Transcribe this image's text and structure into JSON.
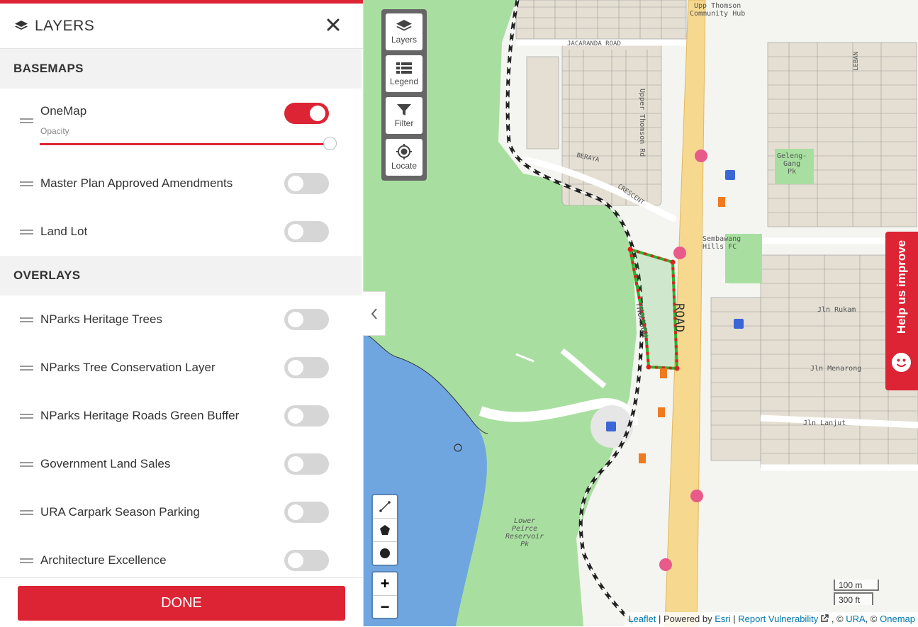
{
  "sidebar": {
    "title": "LAYERS",
    "title_icon": "layers-icon",
    "close_icon": "close-icon",
    "basemaps_heading": "BASEMAPS",
    "onemap": {
      "label": "OneMap",
      "enabled": true,
      "opacity_label": "Opacity",
      "opacity": 1.0
    },
    "basemaps": [
      {
        "label": "Master Plan Approved Amendments",
        "enabled": false
      },
      {
        "label": "Land Lot",
        "enabled": false
      }
    ],
    "overlays_heading": "OVERLAYS",
    "overlays": [
      {
        "label": "NParks Heritage Trees",
        "enabled": false
      },
      {
        "label": "NParks Tree Conservation Layer",
        "enabled": false
      },
      {
        "label": "NParks Heritage Roads Green Buffer",
        "enabled": false
      },
      {
        "label": "Government Land Sales",
        "enabled": false
      },
      {
        "label": "URA Carpark Season Parking",
        "enabled": false
      },
      {
        "label": "Architecture Excellence",
        "enabled": false
      }
    ],
    "done_label": "DONE"
  },
  "map": {
    "toolbar": [
      {
        "label": "Layers",
        "icon": "layers-icon"
      },
      {
        "label": "Legend",
        "icon": "legend-icon"
      },
      {
        "label": "Filter",
        "icon": "filter-icon"
      },
      {
        "label": "Locate",
        "icon": "locate-icon"
      }
    ],
    "draw_tools": [
      "polyline-icon",
      "polygon-icon",
      "circle-icon"
    ],
    "zoom_in": "+",
    "zoom_out": "−",
    "help_label": "Help us improve",
    "scale": {
      "metric": "100 m",
      "imperial": "300 ft"
    },
    "attribution": {
      "leaflet": "Leaflet",
      "sep1": " | Powered by ",
      "esri": "Esri",
      "sep2": " | ",
      "report": "Report Vulnerability",
      "sep3": " , © ",
      "ura": "URA",
      "sep4": ", © ",
      "onemap": "Onemap"
    },
    "labels": {
      "community_hub": "Upp Thomson\nCommunity Hub",
      "jacaranda": "JACARANDA ROAD",
      "upper_thomson_rd": "Upper Thomson Rd",
      "gelenggang_pk": "Geleng-\nGang\nPk",
      "sembawang_hills_fc": "Sembawang\nHills FC",
      "road": "ROAD",
      "thomson": "THOMSON",
      "lower_peirce": "Lower\nPeirce\nReservoir\nPk",
      "jln_rukam": "Jln Rukam",
      "jln_menarong": "Jln Menarong",
      "jln_lanjut": "Jln Lanjut",
      "leban": "LEBAN",
      "beraya": "BERAYA",
      "crescent": "CRESCENT"
    },
    "colors": {
      "accent": "#dc2434",
      "park": "#a8dfa0",
      "water": "#6fa6e0",
      "road_major": "#f6d88f",
      "boundary_highlight": "#29b32e"
    }
  }
}
